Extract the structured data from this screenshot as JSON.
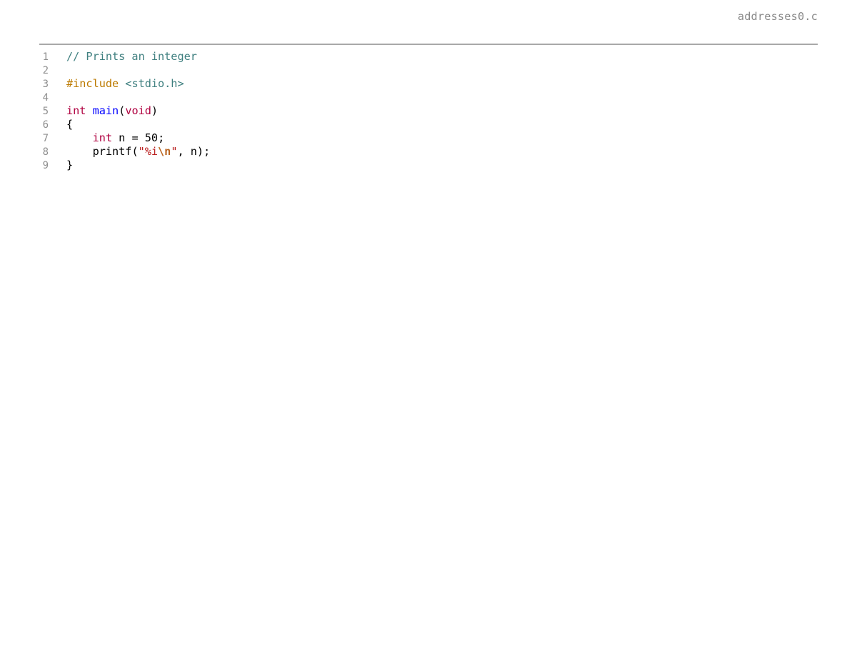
{
  "header": {
    "filename": "addresses0.c"
  },
  "editor": {
    "language": "c",
    "line_count": 9,
    "gutter": [
      "1",
      "2",
      "3",
      "4",
      "5",
      "6",
      "7",
      "8",
      "9"
    ],
    "lines": [
      {
        "number": "1",
        "text": "// Prints an integer",
        "tokens": [
          {
            "t": "// Prints an integer",
            "c": "comment"
          }
        ]
      },
      {
        "number": "2",
        "text": "",
        "tokens": []
      },
      {
        "number": "3",
        "text": "#include <stdio.h>",
        "tokens": [
          {
            "t": "#include ",
            "c": "preproc"
          },
          {
            "t": "<stdio.h>",
            "c": "include"
          }
        ]
      },
      {
        "number": "4",
        "text": "",
        "tokens": []
      },
      {
        "number": "5",
        "text": "int main(void)",
        "tokens": [
          {
            "t": "int",
            "c": "keyword"
          },
          {
            "t": " ",
            "c": "plain"
          },
          {
            "t": "main",
            "c": "func"
          },
          {
            "t": "(",
            "c": "plain"
          },
          {
            "t": "void",
            "c": "keyword"
          },
          {
            "t": ")",
            "c": "plain"
          }
        ]
      },
      {
        "number": "6",
        "text": "{",
        "tokens": [
          {
            "t": "{",
            "c": "plain"
          }
        ]
      },
      {
        "number": "7",
        "text": "    int n = 50;",
        "tokens": [
          {
            "t": "    ",
            "c": "plain"
          },
          {
            "t": "int",
            "c": "keyword"
          },
          {
            "t": " n ",
            "c": "plain"
          },
          {
            "t": "=",
            "c": "plain"
          },
          {
            "t": " ",
            "c": "plain"
          },
          {
            "t": "50",
            "c": "number"
          },
          {
            "t": ";",
            "c": "plain"
          }
        ]
      },
      {
        "number": "8",
        "text": "    printf(\"%i\\n\", n);",
        "tokens": [
          {
            "t": "    printf",
            "c": "plain"
          },
          {
            "t": "(",
            "c": "plain"
          },
          {
            "t": "\"%i",
            "c": "string"
          },
          {
            "t": "\\n",
            "c": "escape"
          },
          {
            "t": "\"",
            "c": "string"
          },
          {
            "t": ", n);",
            "c": "plain"
          }
        ]
      },
      {
        "number": "9",
        "text": "}",
        "tokens": [
          {
            "t": "}",
            "c": "plain"
          }
        ]
      }
    ]
  },
  "colors": {
    "background": "#ffffff",
    "rule": "#a9a9a9",
    "filename": "#888888",
    "line_number": "#8f8f8f",
    "comment": "#408080",
    "preproc": "#bc7a00",
    "include": "#408080",
    "keyword": "#b00040",
    "function": "#0000ff",
    "string": "#ba2121",
    "escape": "#bb6622",
    "text": "#000000"
  }
}
